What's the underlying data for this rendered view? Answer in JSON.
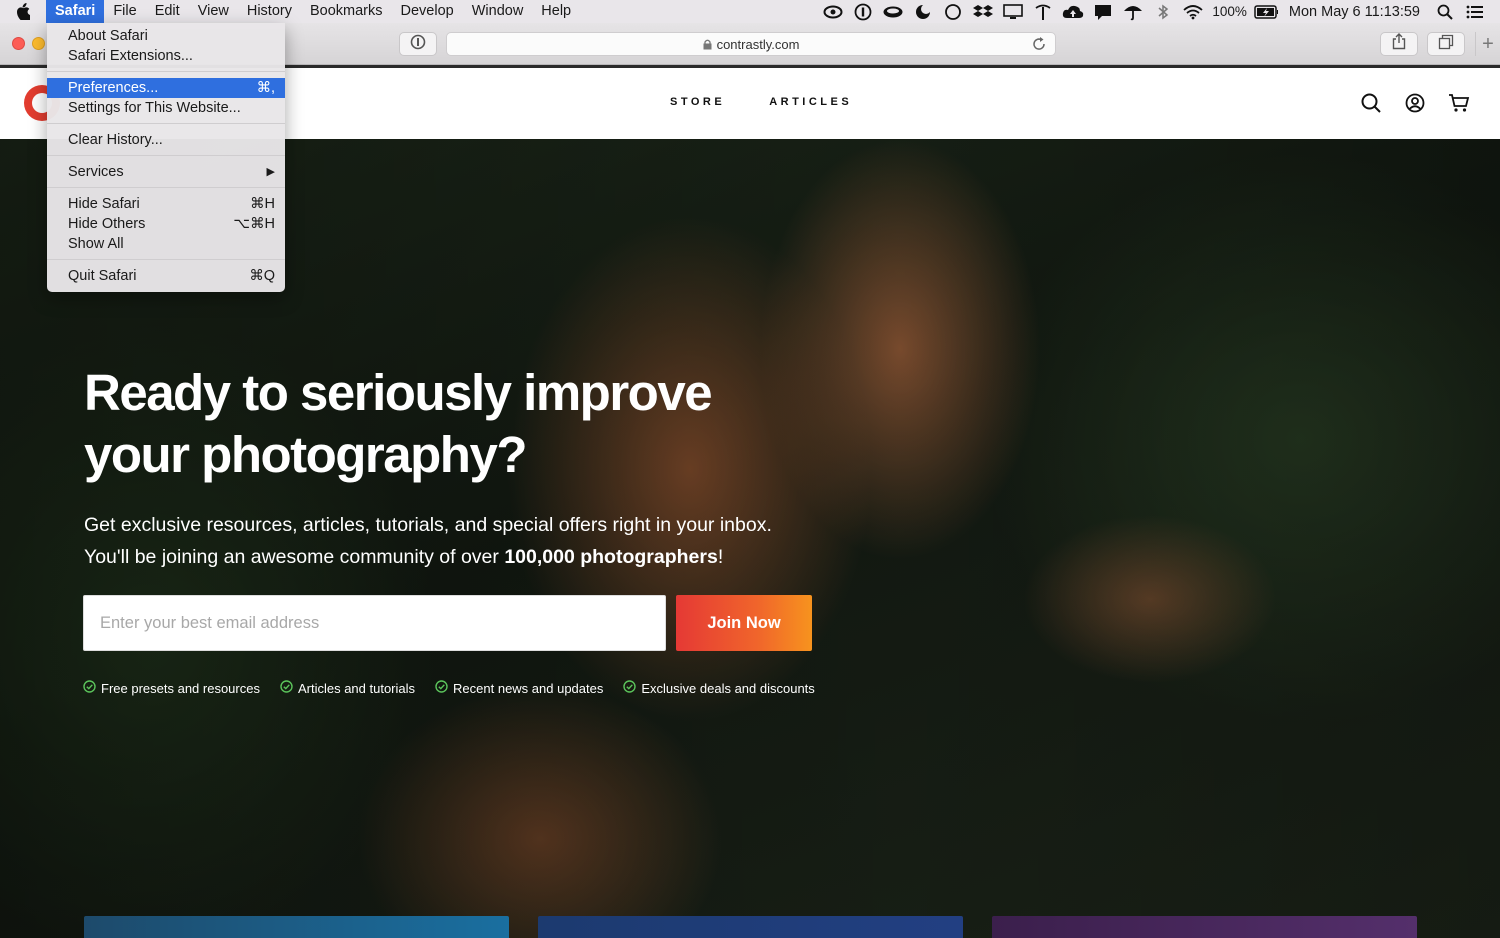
{
  "menubar": {
    "app": "Safari",
    "items": [
      "File",
      "Edit",
      "View",
      "History",
      "Bookmarks",
      "Develop",
      "Window",
      "Help"
    ],
    "battery": "100%",
    "clock": "Mon May 6  11:13:59"
  },
  "browser": {
    "url": "contrastly.com"
  },
  "site": {
    "nav": [
      "STORE",
      "ARTICLES"
    ]
  },
  "hero": {
    "title_line1": "Ready to seriously improve",
    "title_line2": "your photography?",
    "sub_line1": "Get exclusive resources, articles, tutorials, and special offers right in your inbox.",
    "sub_line2_pre": "You'll be joining an awesome community of over ",
    "sub_line2_bold": "100,000 photographers",
    "sub_line2_post": "!",
    "email_placeholder": "Enter your best email address",
    "join_label": "Join Now",
    "features": [
      "Free presets and resources",
      "Articles and tutorials",
      "Recent news and updates",
      "Exclusive deals and discounts"
    ]
  },
  "dropdown": {
    "groups": [
      [
        {
          "label": "About Safari",
          "shortcut": ""
        },
        {
          "label": "Safari Extensions...",
          "shortcut": ""
        }
      ],
      [
        {
          "label": "Preferences...",
          "shortcut": "⌘,"
        },
        {
          "label": "Settings for This Website...",
          "shortcut": ""
        }
      ],
      [
        {
          "label": "Clear History...",
          "shortcut": ""
        }
      ],
      [
        {
          "label": "Services",
          "shortcut": "▶"
        }
      ],
      [
        {
          "label": "Hide Safari",
          "shortcut": "⌘H"
        },
        {
          "label": "Hide Others",
          "shortcut": "⌥⌘H"
        },
        {
          "label": "Show All",
          "shortcut": ""
        }
      ],
      [
        {
          "label": "Quit Safari",
          "shortcut": "⌘Q"
        }
      ]
    ]
  },
  "colors": {
    "menu_highlight": "#2f6fdf",
    "join_gradient_start": "#e53935",
    "join_gradient_end": "#f7931e",
    "check_green": "#5bc35b"
  }
}
